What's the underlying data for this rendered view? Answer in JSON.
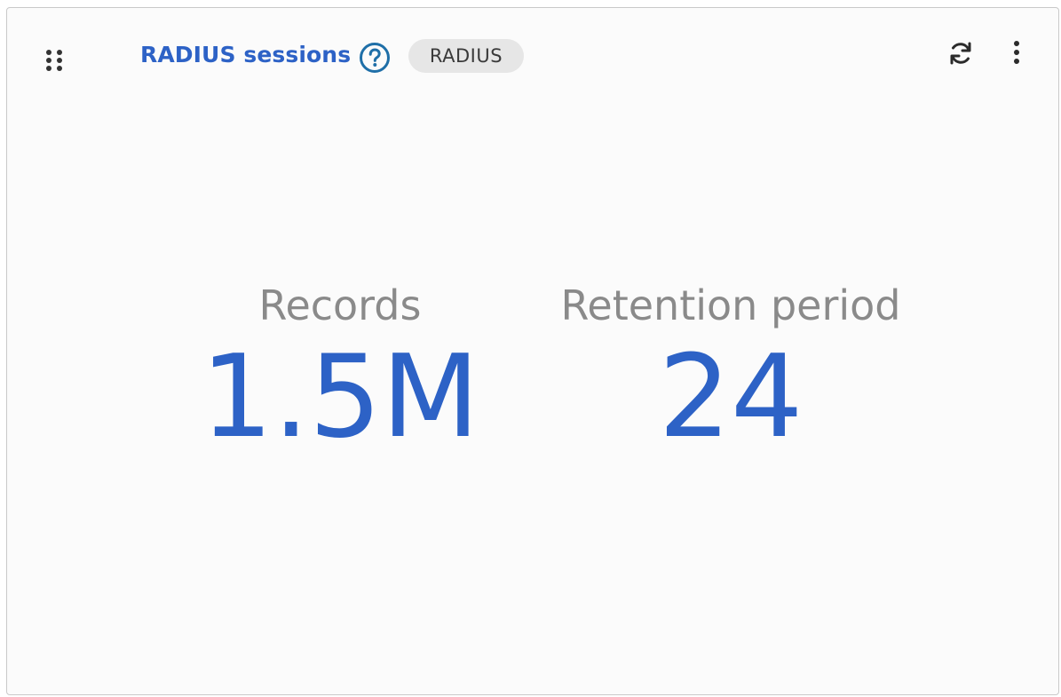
{
  "widget": {
    "title": "RADIUS sessions",
    "badge": "RADIUS",
    "icons": {
      "drag": "drag-handle-icon",
      "help": "help-icon",
      "refresh": "refresh-icon",
      "more": "more-vertical-icon"
    },
    "metrics": [
      {
        "label": "Records",
        "value": "1.5M"
      },
      {
        "label": "Retention period",
        "value": "24"
      }
    ]
  },
  "colors": {
    "accent": "#2d62c6",
    "help_icon": "#1f6fa8",
    "label_gray": "#8a8a8a",
    "badge_bg": "#e6e6e6",
    "card_bg": "#fbfbfb",
    "border": "#c9c9c9"
  }
}
